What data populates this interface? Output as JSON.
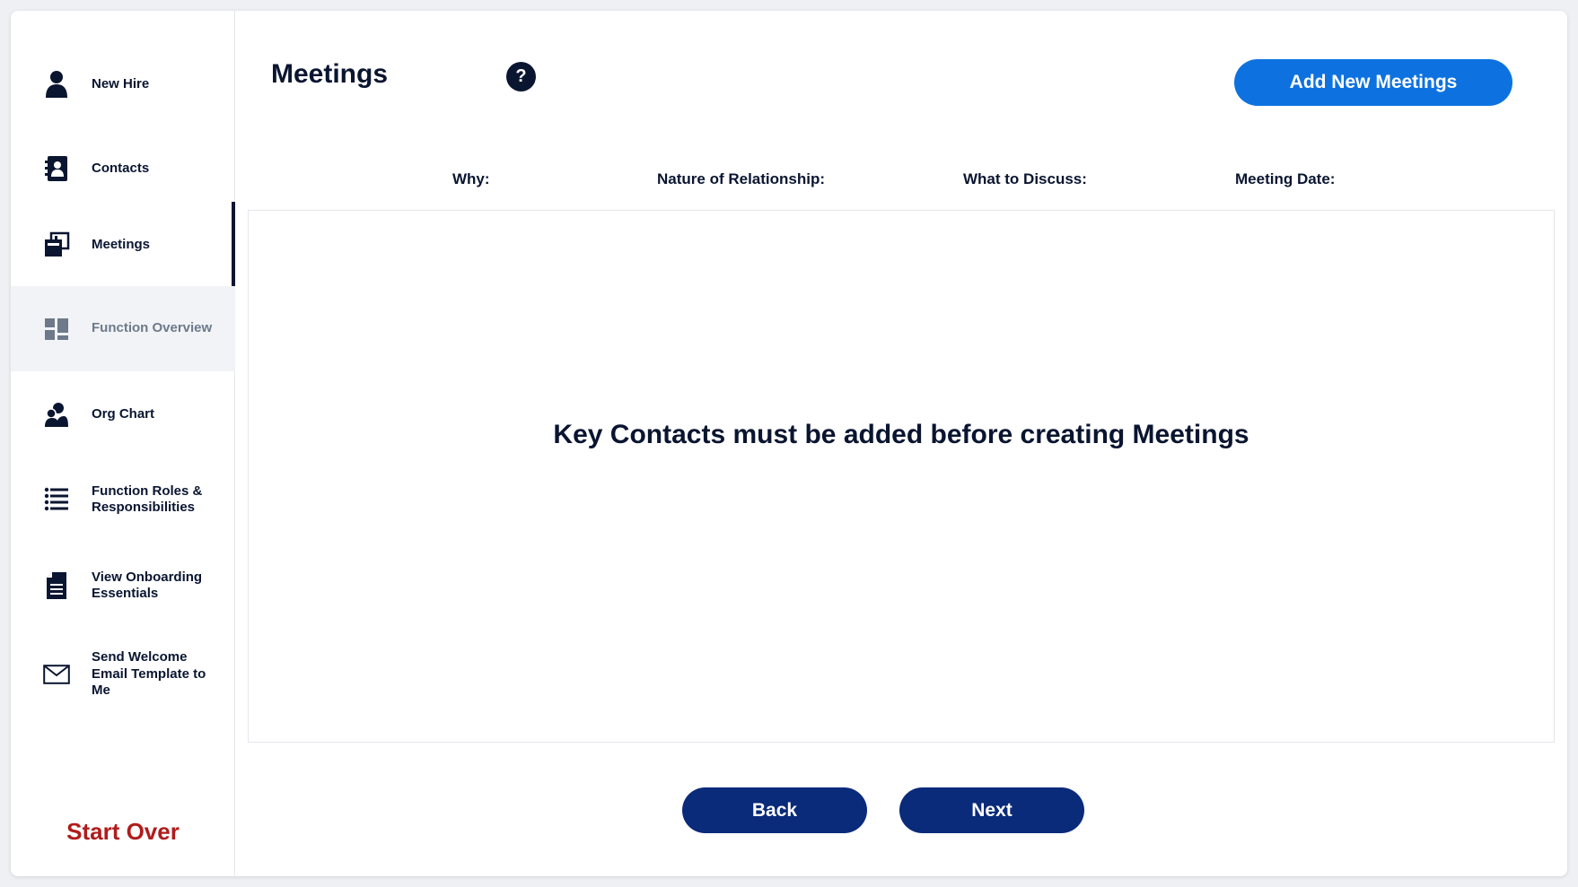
{
  "sidebar": {
    "items": [
      {
        "label": "New Hire",
        "icon": "person-icon"
      },
      {
        "label": "Contacts",
        "icon": "contact-book-icon"
      },
      {
        "label": "Meetings",
        "icon": "meetings-icon"
      },
      {
        "label": "Function Overview",
        "icon": "dashboard-icon"
      },
      {
        "label": "Org Chart",
        "icon": "org-chart-icon"
      },
      {
        "label": "Function Roles & Responsibilities",
        "icon": "list-icon"
      },
      {
        "label": "View Onboarding Essentials",
        "icon": "document-icon"
      },
      {
        "label": "Send Welcome Email Template to Me",
        "icon": "envelope-icon"
      }
    ],
    "active_item": "Meetings",
    "start_over": "Start Over"
  },
  "header": {
    "title": "Meetings",
    "help_glyph": "?",
    "add_button": "Add New Meetings"
  },
  "table": {
    "columns": [
      "Why:",
      "Nature of Relationship:",
      "What to Discuss:",
      "Meeting Date:"
    ],
    "empty_message": "Key Contacts must be added before creating Meetings"
  },
  "footer": {
    "back": "Back",
    "next": "Next"
  },
  "colors": {
    "navy": "#0a1530",
    "accent_blue": "#0d72e0",
    "button_navy": "#0a2a7a",
    "start_over_red": "#b01c1c"
  }
}
